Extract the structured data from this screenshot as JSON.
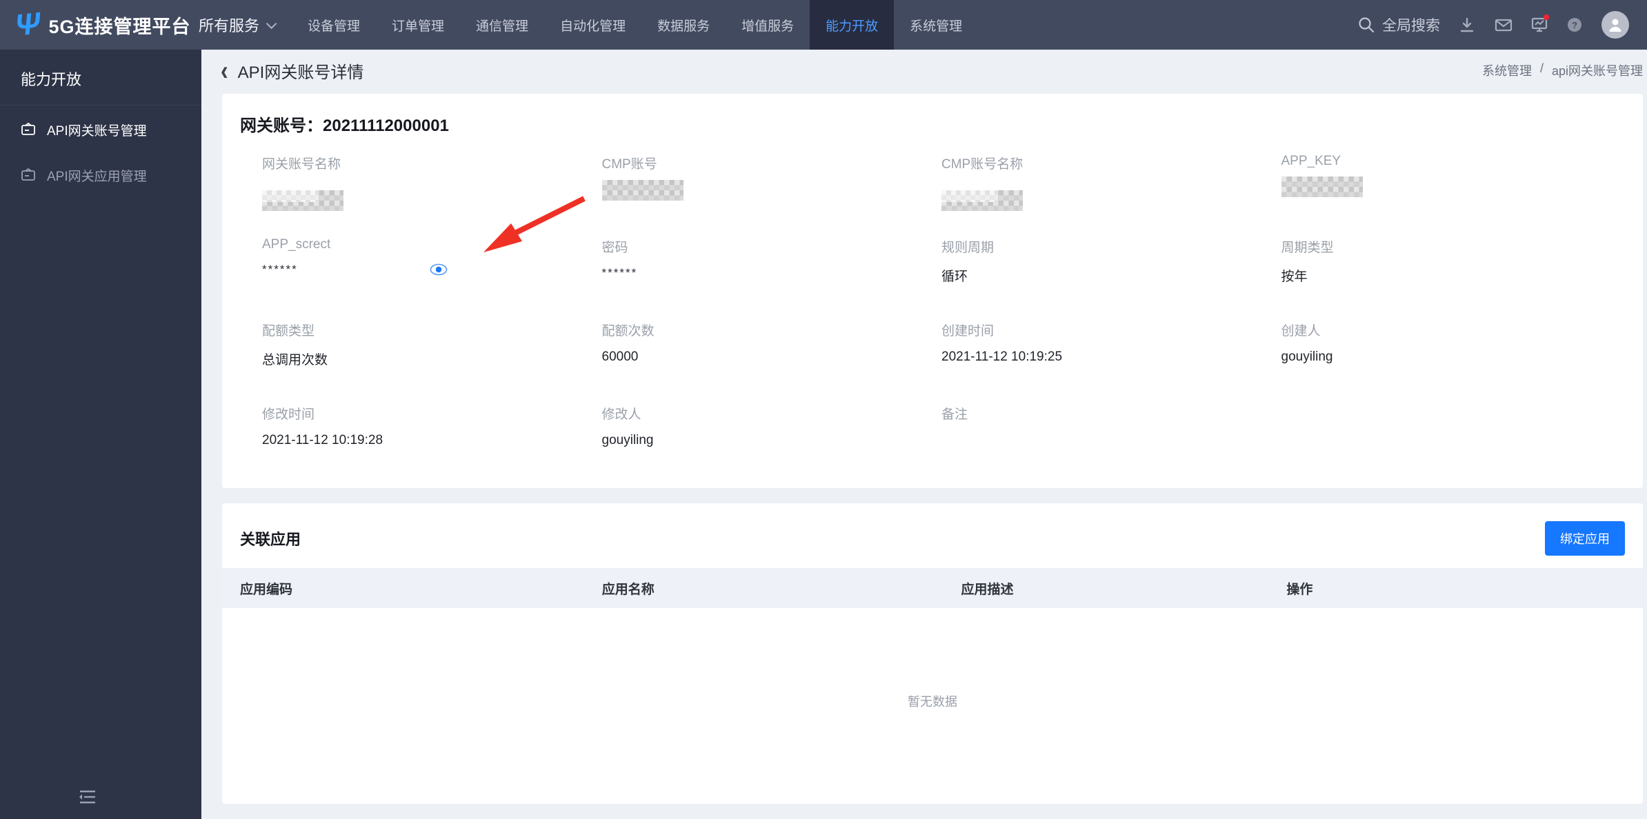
{
  "colors": {
    "topbar_bg": "#424a60",
    "sidebar_bg": "#2e3447",
    "accent_blue": "#1677ff",
    "active_nav_text": "#4d9bff",
    "annotation_red": "#ee3124"
  },
  "icons": {
    "back": "‹",
    "breadcrumb_separator": "/",
    "logo_glyph": "Ψ",
    "top_icons": [
      "search-icon",
      "download-icon",
      "mail-icon",
      "monitor-chart-icon",
      "help-icon",
      "avatar"
    ],
    "field_eye": "eye-icon",
    "sidebar_item_icon": "id-card-icon",
    "collapse": "menu-fold-icon"
  },
  "topbar": {
    "logo_text": "5G连接管理平台",
    "all_services": "所有服务",
    "nav_items": [
      {
        "label": "设备管理"
      },
      {
        "label": "订单管理"
      },
      {
        "label": "通信管理"
      },
      {
        "label": "自动化管理"
      },
      {
        "label": "数据服务"
      },
      {
        "label": "增值服务"
      },
      {
        "label": "能力开放",
        "active": true
      },
      {
        "label": "系统管理"
      }
    ],
    "search_label": "全局搜索"
  },
  "sidebar": {
    "title": "能力开放",
    "items": [
      {
        "label": "API网关账号管理",
        "active": true
      },
      {
        "label": "API网关应用管理",
        "active": false
      }
    ]
  },
  "page_header": {
    "title": "API网关账号详情",
    "breadcrumb": [
      "系统管理",
      "api网关账号管理"
    ]
  },
  "detail_card": {
    "title_label": "网关账号：",
    "account_id": "20211112000001",
    "fields": [
      {
        "label": "网关账号名称",
        "value": "",
        "masked": true
      },
      {
        "label": "CMP账号",
        "value": "",
        "masked": true
      },
      {
        "label": "CMP账号名称",
        "value": "",
        "masked": true
      },
      {
        "label": "APP_KEY",
        "value": "",
        "masked": true
      },
      {
        "label": "APP_screct",
        "value": "******",
        "has_eye_toggle": true
      },
      {
        "label": "密码",
        "value": "******"
      },
      {
        "label": "规则周期",
        "value": "循环"
      },
      {
        "label": "周期类型",
        "value": "按年"
      },
      {
        "label": "配额类型",
        "value": "总调用次数"
      },
      {
        "label": "配额次数",
        "value": "60000"
      },
      {
        "label": "创建时间",
        "value": "2021-11-12 10:19:25"
      },
      {
        "label": "创建人",
        "value": "gouyiling"
      },
      {
        "label": "修改时间",
        "value": "2021-11-12 10:19:28"
      },
      {
        "label": "修改人",
        "value": "gouyiling"
      },
      {
        "label": "备注",
        "value": ""
      }
    ]
  },
  "related_card": {
    "title": "关联应用",
    "bind_button_label": "绑定应用",
    "table": {
      "headers": [
        "应用编码",
        "应用名称",
        "应用描述",
        "操作"
      ],
      "rows": [],
      "empty_text": "暂无数据"
    }
  }
}
